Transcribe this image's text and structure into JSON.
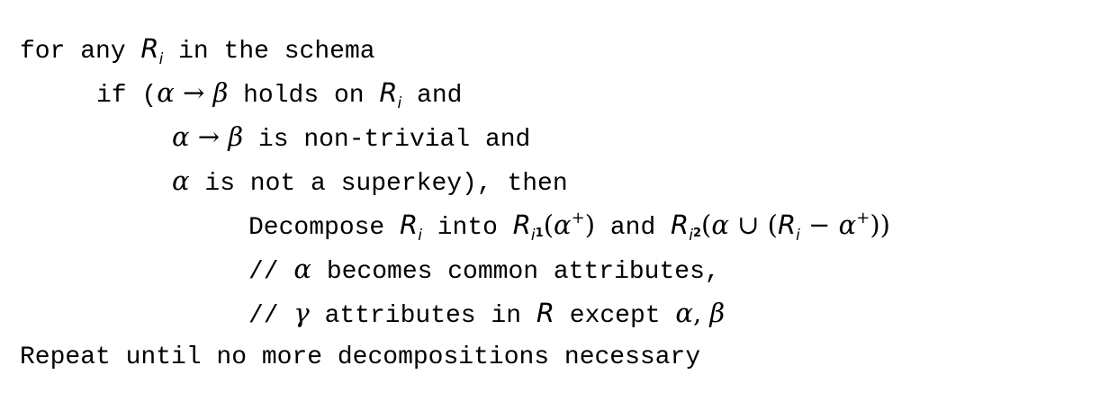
{
  "algorithm": {
    "line1": {
      "a": "for any ",
      "var": "R",
      "sub": "i",
      "b": " in the schema"
    },
    "line2": {
      "a": "if (",
      "alpha": "α",
      "arrow": " → ",
      "beta": "β",
      "b": " holds on ",
      "var": "R",
      "sub": "i",
      "c": " and"
    },
    "line3": {
      "alpha": "α",
      "arrow": " → ",
      "beta": "β",
      "b": " is non-trivial and"
    },
    "line4": {
      "alpha": "α",
      "b": " is not a superkey), then"
    },
    "line5": {
      "a": "Decompose ",
      "var1": "R",
      "sub1": "i",
      "b": " into ",
      "var2": "R",
      "sub2": "i",
      "subsub2": "1",
      "open2": "(",
      "alpha2": "α",
      "plus2": "+",
      "close2": ")",
      "c": " and ",
      "var3": "R",
      "sub3": "i",
      "subsub3": "2",
      "open3": "(",
      "alpha3": "α",
      "cup3": " ∪ ",
      "open3b": "(",
      "var4": "R",
      "sub4": "i",
      "minus4": " − ",
      "alpha4": "α",
      "plus4": "+",
      "close4": "))"
    },
    "line6": {
      "a": "// ",
      "alpha": "α",
      "b": " becomes common attributes,"
    },
    "line7": {
      "a": "// ",
      "gamma": "γ",
      "b": " attributes in ",
      "var": "R",
      "c": " except ",
      "alpha": "α",
      "comma": ", ",
      "beta": "β"
    },
    "line8": {
      "a": "Repeat until no more decompositions necessary"
    }
  }
}
